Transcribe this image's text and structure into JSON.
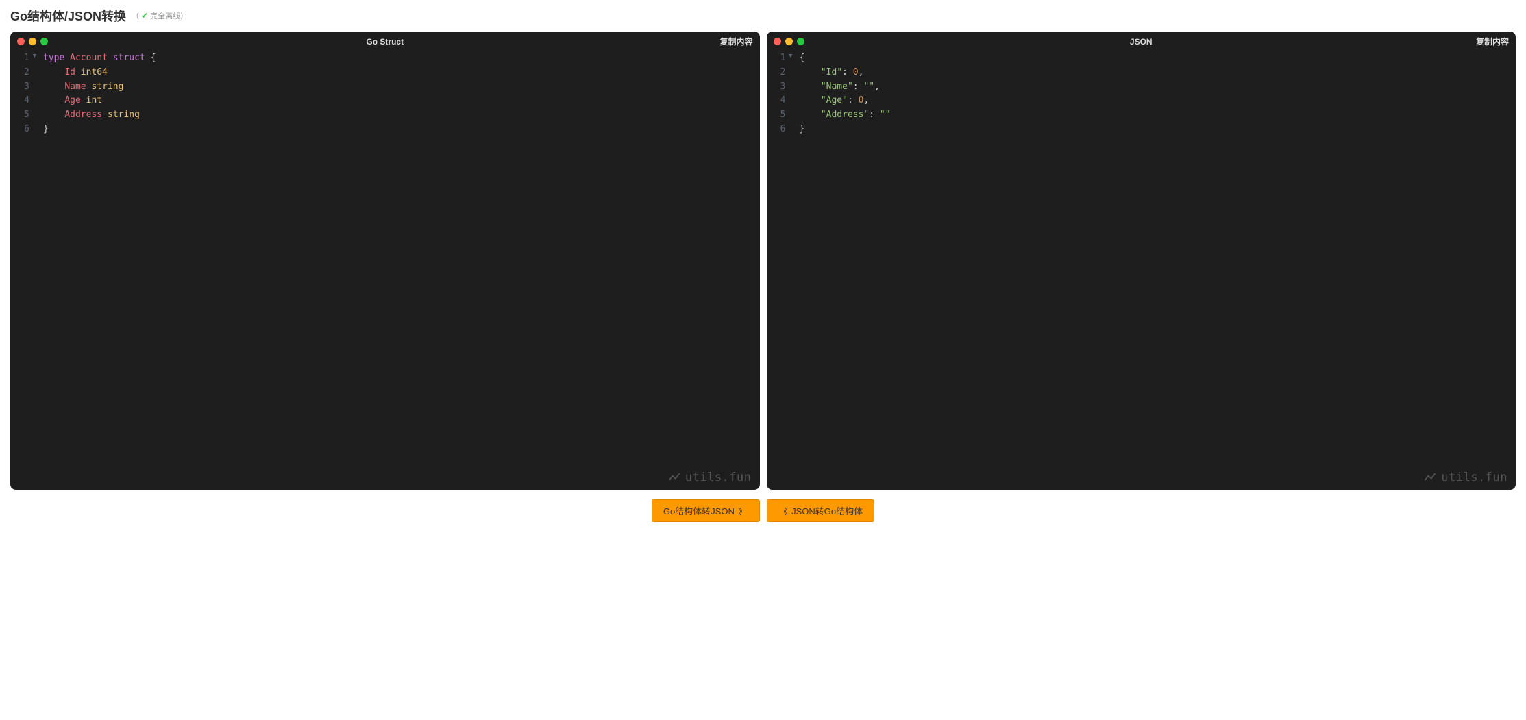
{
  "header": {
    "title": "Go结构体/JSON转换",
    "badge_prefix": "（",
    "badge_check": "✔",
    "badge_text": " 完全离线）"
  },
  "panels": {
    "left": {
      "title": "Go Struct",
      "copy_label": "复制内容"
    },
    "right": {
      "title": "JSON",
      "copy_label": "复制内容"
    }
  },
  "code_left": {
    "lines": [
      "1",
      "2",
      "3",
      "4",
      "5",
      "6"
    ],
    "tokens": [
      [
        {
          "t": "keyword",
          "v": "type"
        },
        {
          "t": "sp",
          "v": " "
        },
        {
          "t": "ident",
          "v": "Account"
        },
        {
          "t": "sp",
          "v": " "
        },
        {
          "t": "keyword",
          "v": "struct"
        },
        {
          "t": "sp",
          "v": " "
        },
        {
          "t": "brace",
          "v": "{"
        }
      ],
      [
        {
          "t": "sp",
          "v": "    "
        },
        {
          "t": "ident",
          "v": "Id"
        },
        {
          "t": "sp",
          "v": " "
        },
        {
          "t": "type",
          "v": "int64"
        }
      ],
      [
        {
          "t": "sp",
          "v": "    "
        },
        {
          "t": "ident",
          "v": "Name"
        },
        {
          "t": "sp",
          "v": " "
        },
        {
          "t": "type",
          "v": "string"
        }
      ],
      [
        {
          "t": "sp",
          "v": "    "
        },
        {
          "t": "ident",
          "v": "Age"
        },
        {
          "t": "sp",
          "v": " "
        },
        {
          "t": "type",
          "v": "int"
        }
      ],
      [
        {
          "t": "sp",
          "v": "    "
        },
        {
          "t": "ident",
          "v": "Address"
        },
        {
          "t": "sp",
          "v": " "
        },
        {
          "t": "type",
          "v": "string"
        }
      ],
      [
        {
          "t": "brace",
          "v": "}"
        }
      ]
    ]
  },
  "code_right": {
    "lines": [
      "1",
      "2",
      "3",
      "4",
      "5",
      "6"
    ],
    "tokens": [
      [
        {
          "t": "brace",
          "v": "{"
        }
      ],
      [
        {
          "t": "sp",
          "v": "    "
        },
        {
          "t": "string",
          "v": "\"Id\""
        },
        {
          "t": "punct",
          "v": ": "
        },
        {
          "t": "number",
          "v": "0"
        },
        {
          "t": "punct",
          "v": ","
        }
      ],
      [
        {
          "t": "sp",
          "v": "    "
        },
        {
          "t": "string",
          "v": "\"Name\""
        },
        {
          "t": "punct",
          "v": ": "
        },
        {
          "t": "string",
          "v": "\"\""
        },
        {
          "t": "punct",
          "v": ","
        }
      ],
      [
        {
          "t": "sp",
          "v": "    "
        },
        {
          "t": "string",
          "v": "\"Age\""
        },
        {
          "t": "punct",
          "v": ": "
        },
        {
          "t": "number",
          "v": "0"
        },
        {
          "t": "punct",
          "v": ","
        }
      ],
      [
        {
          "t": "sp",
          "v": "    "
        },
        {
          "t": "string",
          "v": "\"Address\""
        },
        {
          "t": "punct",
          "v": ": "
        },
        {
          "t": "string",
          "v": "\"\""
        }
      ],
      [
        {
          "t": "brace",
          "v": "}"
        }
      ]
    ]
  },
  "watermark": "utils.fun",
  "actions": {
    "to_json": "Go结构体转JSON",
    "to_struct": "JSON转Go结构体",
    "arrow_right": "》",
    "arrow_left": "《"
  }
}
